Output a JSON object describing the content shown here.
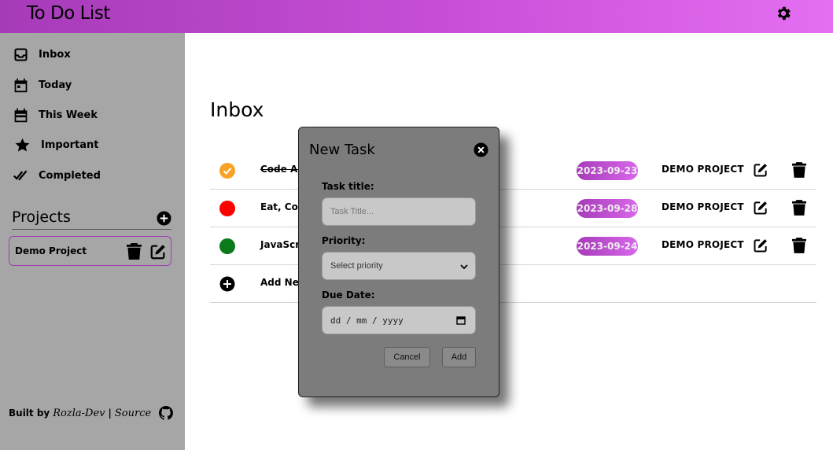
{
  "app": {
    "title": "To Do List",
    "theme_icon": "gear-icon"
  },
  "sidebar": {
    "items": [
      {
        "label": "Inbox",
        "icon": "inbox-icon"
      },
      {
        "label": "Today",
        "icon": "calendar-icon"
      },
      {
        "label": "This Week",
        "icon": "calendar-icon"
      },
      {
        "label": "Important",
        "icon": "star-icon"
      },
      {
        "label": "Completed",
        "icon": "double-check-icon"
      }
    ],
    "projects_title": "Projects",
    "projects": [
      {
        "name": "Demo Project"
      }
    ],
    "footer": {
      "built_by": "Built by",
      "author": "Rozla-Dev",
      "separator": "|",
      "source": "Source"
    }
  },
  "main": {
    "title": "Inbox",
    "tasks": [
      {
        "title": "Code All",
        "status_color": "#f7a325",
        "completed": true,
        "date": "2023-09-23",
        "project": "DEMO PROJECT"
      },
      {
        "title": "Eat, Code",
        "status_color": "#ff0000",
        "completed": false,
        "date": "2023-09-28",
        "project": "DEMO PROJECT"
      },
      {
        "title": "JavaScrip",
        "status_color": "#0a7a1a",
        "completed": false,
        "date": "2023-09-24",
        "project": "DEMO PROJECT"
      }
    ],
    "add_task_label": "Add New"
  },
  "modal": {
    "title": "New Task",
    "task_title_label": "Task title:",
    "task_title_placeholder": "Task Title...",
    "priority_label": "Priority:",
    "priority_value": "Select priority",
    "due_date_label": "Due Date:",
    "due_date_value": "dd / mm / yyyy",
    "cancel_label": "Cancel",
    "add_label": "Add"
  },
  "colors": {
    "accent_start": "#a63bb8",
    "accent_end": "#e56ff2",
    "sidebar_bg": "#a6a6a6",
    "modal_bg": "#7c7c7c"
  }
}
